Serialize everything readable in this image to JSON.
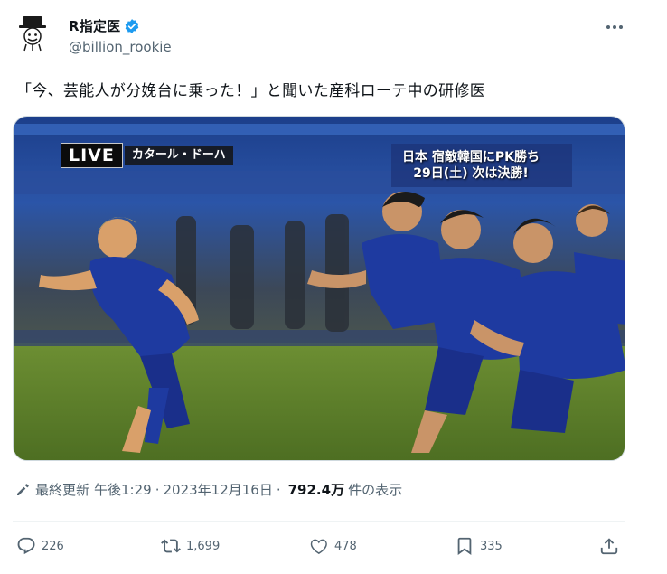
{
  "author": {
    "display_name": "R指定医",
    "handle": "@billion_rookie",
    "verified": true,
    "avatar_icon": "top-hat-mascot-avatar"
  },
  "tweet": {
    "text": "「今、芸能人が分娩台に乗った！」と聞いた産科ローテ中の研修医"
  },
  "media": {
    "live_label": "LIVE",
    "location_label": "カタール・ドーハ",
    "caption_line1": "日本 宿敵韓国にPK勝ち",
    "caption_line2": "29日(土) 次は決勝!"
  },
  "meta": {
    "edited_label": "最終更新",
    "time": "午後1:29",
    "separator": "·",
    "date": "2023年12月16日",
    "views_count": "792.4万",
    "views_label": "件の表示"
  },
  "actions": {
    "replies": "226",
    "retweets": "1,699",
    "likes": "478",
    "bookmarks": "335"
  },
  "colors": {
    "text_primary": "#0f1419",
    "text_secondary": "#536471",
    "verified_blue": "#1d9bf0",
    "border": "#eff3f4"
  }
}
